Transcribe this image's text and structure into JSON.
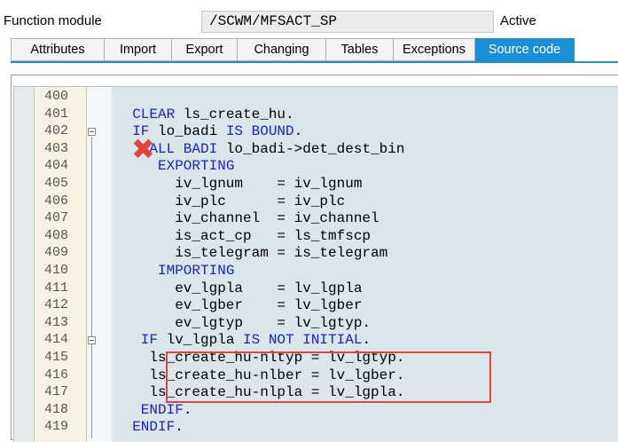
{
  "header": {
    "label": "Function module",
    "name": "/SCWM/MFSACT_SP",
    "status": "Active"
  },
  "tabs": [
    {
      "label": "Attributes",
      "active": false
    },
    {
      "label": "Import",
      "active": false
    },
    {
      "label": "Export",
      "active": false
    },
    {
      "label": "Changing",
      "active": false
    },
    {
      "label": "Tables",
      "active": false
    },
    {
      "label": "Exceptions",
      "active": false
    },
    {
      "label": "Source code",
      "active": true
    }
  ],
  "colors": {
    "accent": "#1b8fd6",
    "keyword": "#1a23c8",
    "highlight": "#e0443a"
  },
  "icons": {
    "error_marker": "red-x-icon",
    "fold": "collapse-square-icon"
  },
  "code_lines": [
    {
      "num": "400",
      "indent": 0,
      "kw": "",
      "text": ""
    },
    {
      "num": "401",
      "indent": 3,
      "kw": "CLEAR",
      "text": " ls_create_hu."
    },
    {
      "num": "402",
      "indent": 3,
      "kw": "IF",
      "text": " lo_badi ",
      "kw2": "IS BOUND",
      "text2": "."
    },
    {
      "num": "403",
      "indent": 4,
      "kw": "CALL BADI",
      "text": " lo_badi->det_dest_bin"
    },
    {
      "num": "404",
      "indent": 6,
      "kw": "EXPORTING",
      "text": ""
    },
    {
      "num": "405",
      "indent": 8,
      "kw": "",
      "text": "iv_lgnum    = iv_lgnum"
    },
    {
      "num": "406",
      "indent": 8,
      "kw": "",
      "text": "iv_plc      = iv_plc"
    },
    {
      "num": "407",
      "indent": 8,
      "kw": "",
      "text": "iv_channel  = iv_channel"
    },
    {
      "num": "408",
      "indent": 8,
      "kw": "",
      "text": "is_act_cp   = ls_tmfscp"
    },
    {
      "num": "409",
      "indent": 8,
      "kw": "",
      "text": "is_telegram = is_telegram"
    },
    {
      "num": "410",
      "indent": 6,
      "kw": "IMPORTING",
      "text": ""
    },
    {
      "num": "411",
      "indent": 8,
      "kw": "",
      "text": "ev_lgpla    = lv_lgpla"
    },
    {
      "num": "412",
      "indent": 8,
      "kw": "",
      "text": "ev_lgber    = lv_lgber"
    },
    {
      "num": "413",
      "indent": 8,
      "kw": "",
      "text": "ev_lgtyp    = lv_lgtyp."
    },
    {
      "num": "414",
      "indent": 4,
      "kw": "IF",
      "text": " lv_lgpla ",
      "kw2": "IS NOT INITIAL",
      "text2": "."
    },
    {
      "num": "415",
      "indent": 5,
      "kw": "",
      "text": "ls_create_hu-nltyp = lv_lgtyp."
    },
    {
      "num": "416",
      "indent": 5,
      "kw": "",
      "text": "ls_create_hu-nlber = lv_lgber."
    },
    {
      "num": "417",
      "indent": 5,
      "kw": "",
      "text": "ls_create_hu-nlpla = lv_lgpla."
    },
    {
      "num": "418",
      "indent": 4,
      "kw": "ENDIF",
      "text": "."
    },
    {
      "num": "419",
      "indent": 3,
      "kw": "ENDIF",
      "text": "."
    }
  ]
}
